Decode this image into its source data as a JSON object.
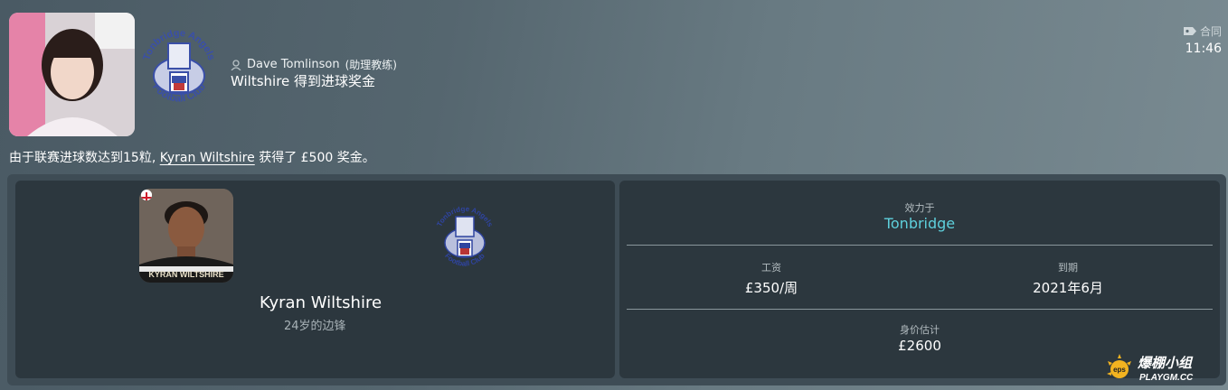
{
  "message": {
    "sender_name": "Dave Tomlinson",
    "sender_role": "(助理教练)",
    "subject": "Wiltshire 得到进球奖金",
    "tag": "合同",
    "time": "11:46",
    "body_prefix": "由于联赛进球数达到15粒,",
    "body_player": "Kyran Wiltshire",
    "body_suffix": "获得了 £500 奖金。"
  },
  "crest": {
    "top_text": "Tonbridge Angels",
    "bottom_text": "Football Club"
  },
  "player": {
    "name": "Kyran Wiltshire",
    "subtitle": "24岁的边锋",
    "shirt_text": "KYRAN WILTSHIRE"
  },
  "contract": {
    "club_label": "效力于",
    "club_value": "Tonbridge",
    "wage_label": "工资",
    "wage_value": "£350/周",
    "expiry_label": "到期",
    "expiry_value": "2021年6月",
    "value_label": "身价估计",
    "value_value": "£2600"
  },
  "watermark": {
    "brand": "爆棚小组",
    "site": "PLAYGM.CC",
    "badge": "eps"
  }
}
